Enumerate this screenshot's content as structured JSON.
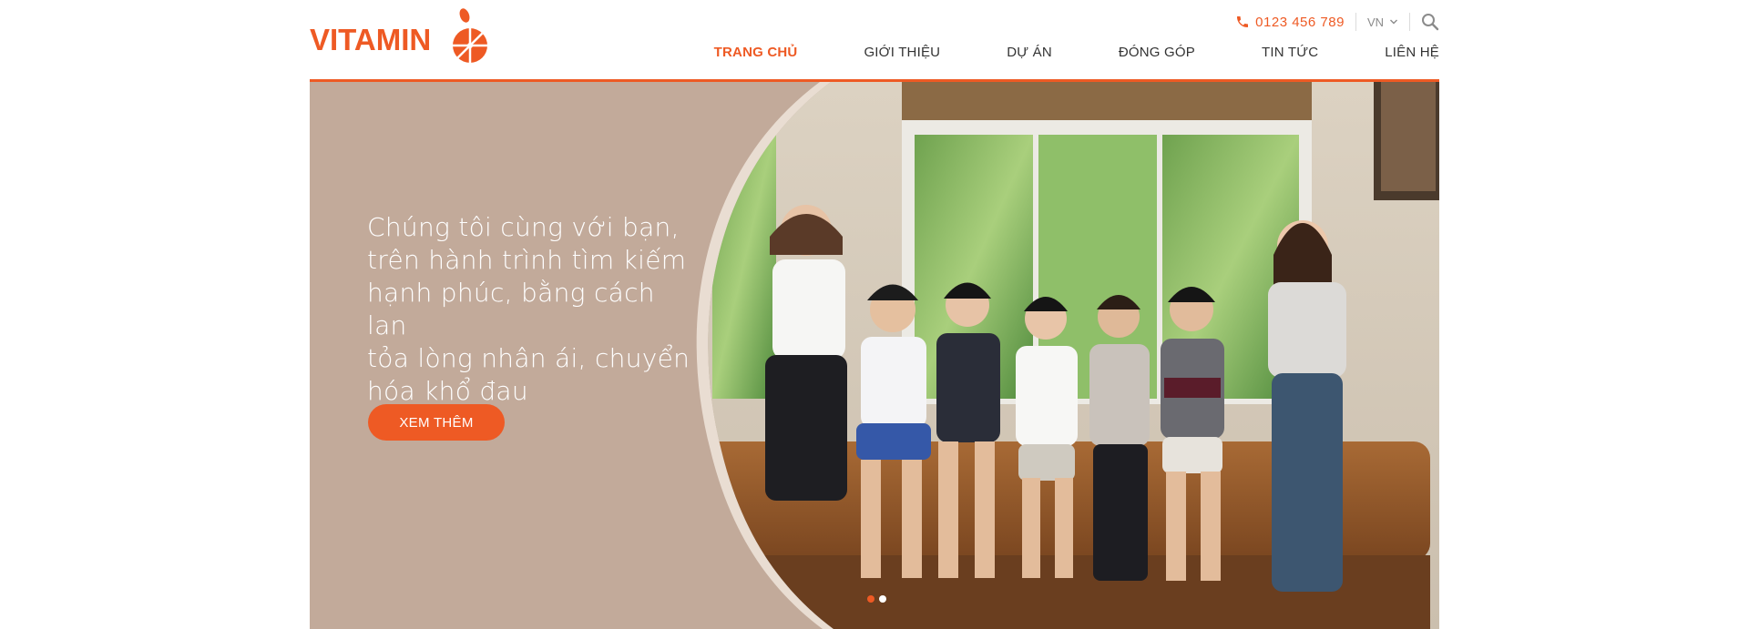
{
  "brand": {
    "name": "VITAMIN",
    "accent_color": "#ee5a24"
  },
  "topbar": {
    "phone": "0123 456 789",
    "phone_icon": "phone-icon",
    "language": "VN",
    "language_icon": "chevron-down-icon",
    "search_icon": "search-icon"
  },
  "nav": {
    "items": [
      {
        "label": "TRANG CHỦ",
        "active": true
      },
      {
        "label": "GIỚI THIỆU",
        "active": false
      },
      {
        "label": "DỰ ÁN",
        "active": false
      },
      {
        "label": "ĐÓNG GÓP",
        "active": false
      },
      {
        "label": "TIN TỨC",
        "active": false
      },
      {
        "label": "LIÊN HỆ",
        "active": false
      }
    ]
  },
  "hero": {
    "headline_lines": [
      "Chúng tôi cùng với bạn,",
      "trên hành trình tìm kiếm",
      "hạnh phúc, bằng cách lan",
      "tỏa lòng nhân ái, chuyển",
      "hóa khổ đau"
    ],
    "button_label": "XEM THÊM",
    "panel_color": "#c2aa9a",
    "slides": {
      "count": 2,
      "active_index": 0
    },
    "dot_colors": {
      "active": "#ee5a24",
      "inactive": "#ffffff"
    }
  }
}
